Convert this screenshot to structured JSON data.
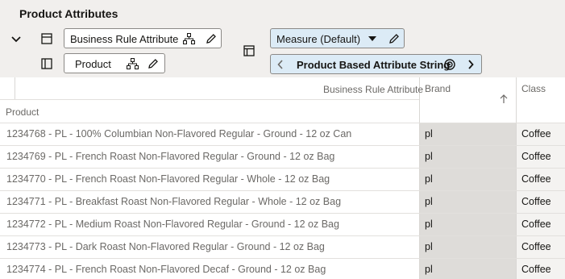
{
  "page": {
    "title": "Product Attributes"
  },
  "toolbar": {
    "row_attribute_label": "Business Rule Attribute",
    "row_product_label": "Product",
    "measure_label": "Measure (Default)",
    "attribute_string_label": "Product Based Attribute String"
  },
  "grid": {
    "header_business_rule": "Business Rule Attribute",
    "header_product": "Product",
    "header_brand": "Brand",
    "header_class": "Class",
    "rows": [
      {
        "product": "1234768 - PL - 100% Columbian Non-Flavored Regular - Ground - 12 oz Can",
        "brand": "pl",
        "class": "Coffee"
      },
      {
        "product": "1234769 - PL - French Roast Non-Flavored Regular - Ground - 12 oz Bag",
        "brand": "pl",
        "class": "Coffee"
      },
      {
        "product": "1234770 - PL - French Roast Non-Flavored Regular - Whole - 12 oz Bag",
        "brand": "pl",
        "class": "Coffee"
      },
      {
        "product": "1234771 - PL - Breakfast Roast Non-Flavored Regular - Whole - 12 oz Bag",
        "brand": "pl",
        "class": "Coffee"
      },
      {
        "product": "1234772 - PL - Medium Roast Non-Flavored Regular - Ground - 12 oz Bag",
        "brand": "pl",
        "class": "Coffee"
      },
      {
        "product": "1234773 - PL - Dark Roast Non-Flavored Regular - Ground - 12 oz Bag",
        "brand": "pl",
        "class": "Coffee"
      },
      {
        "product": "1234774 - PL - French Roast Non-Flavored Decaf - Ground - 12 oz Bag",
        "brand": "pl",
        "class": "Coffee"
      }
    ]
  },
  "colors": {
    "header_bg": "#f1efed",
    "selected_pill_bg": "#dcebf6",
    "brand_cell_bg": "#dedcd9"
  },
  "icons": [
    "chevron-down-icon",
    "table-layout-icon",
    "hierarchy-icon",
    "edit-icon",
    "sidebar-icon",
    "pivot-icon",
    "chevron-left-icon",
    "chevron-right-icon",
    "target-icon",
    "sort-ascending-icon"
  ]
}
